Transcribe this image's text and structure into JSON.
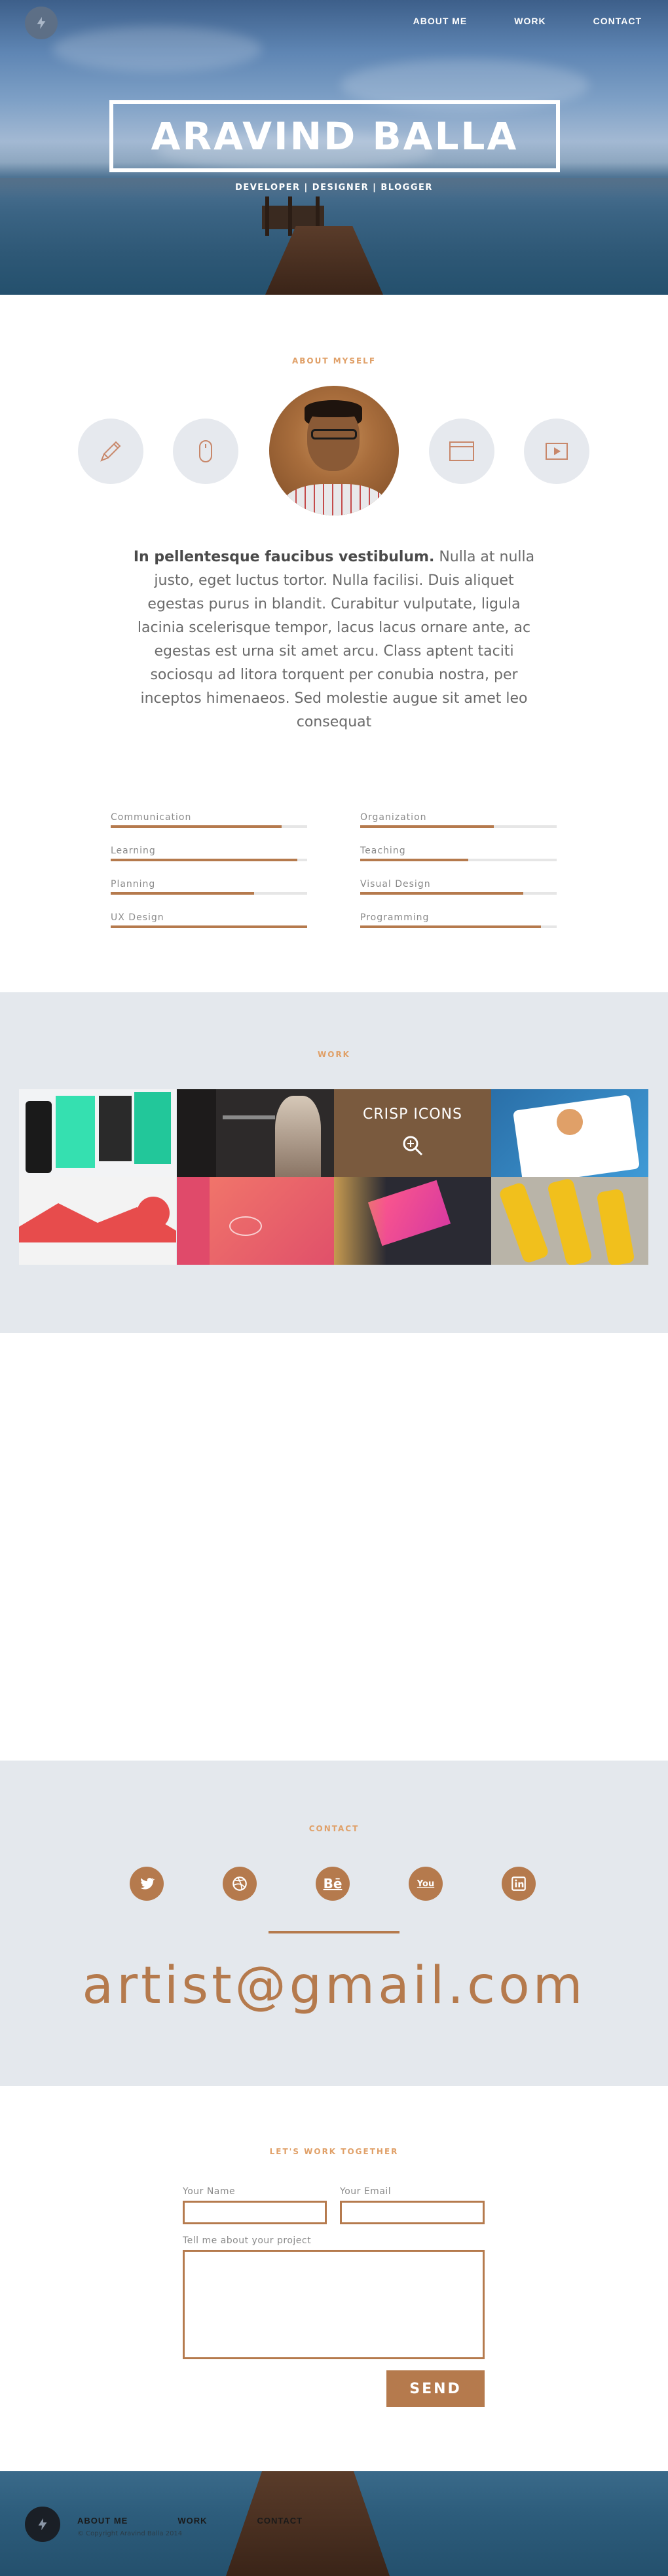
{
  "header": {
    "logo_icon": "lightning-bolt-icon",
    "nav": [
      "ABOUT ME",
      "WORK",
      "CONTACT"
    ],
    "title": "ARAVIND BALLA",
    "subtitle": "DEVELOPER | DESIGNER | BLOGGER"
  },
  "about": {
    "label": "ABOUT MYSELF",
    "icons": [
      "pencil-icon",
      "mouse-icon",
      "browser-window-icon",
      "video-play-icon"
    ],
    "bio_bold": "In pellentesque faucibus vestibulum.",
    "bio_text": " Nulla at nulla justo, eget luctus tortor. Nulla facilisi. Duis aliquet egestas purus in blandit. Curabitur vulputate, ligula lacinia scelerisque tempor, lacus lacus ornare ante, ac egestas est urna sit amet arcu. Class aptent taciti sociosqu ad litora torquent per conubia nostra, per inceptos himenaeos. Sed molestie augue sit amet leo consequat"
  },
  "skills": [
    {
      "label": "Communication",
      "level": 0.87
    },
    {
      "label": "Organization",
      "level": 0.68
    },
    {
      "label": "Learning",
      "level": 0.95
    },
    {
      "label": "Teaching",
      "level": 0.55
    },
    {
      "label": "Planning",
      "level": 0.73
    },
    {
      "label": "Visual Design",
      "level": 0.83
    },
    {
      "label": "UX Design",
      "level": 1.0
    },
    {
      "label": "Programming",
      "level": 0.92
    }
  ],
  "work": {
    "label": "WORK",
    "tiles": [
      "",
      "",
      "CRISP ICONS",
      "",
      "",
      "",
      "",
      ""
    ]
  },
  "contact": {
    "label": "CONTACT",
    "social": [
      "twitter-icon",
      "dribbble-icon",
      "behance-icon",
      "youtube-icon",
      "linkedin-icon"
    ],
    "social_text": {
      "behance": "Bē",
      "youtube": "You"
    },
    "email": "artist@gmail.com"
  },
  "form": {
    "label": "LET'S WORK TOGETHER",
    "name_label": "Your Name",
    "email_label": "Your Email",
    "message_label": "Tell me about your project",
    "send": "SEND"
  },
  "footer": {
    "nav": [
      "ABOUT ME",
      "WORK",
      "CONTACT"
    ],
    "copyright": "© Copyright Aravind Balla 2014"
  },
  "colors": {
    "accent": "#b57a4d",
    "label": "#e0a068",
    "panel": "#e4e8ed",
    "icon_bg": "#e6e9ee"
  }
}
